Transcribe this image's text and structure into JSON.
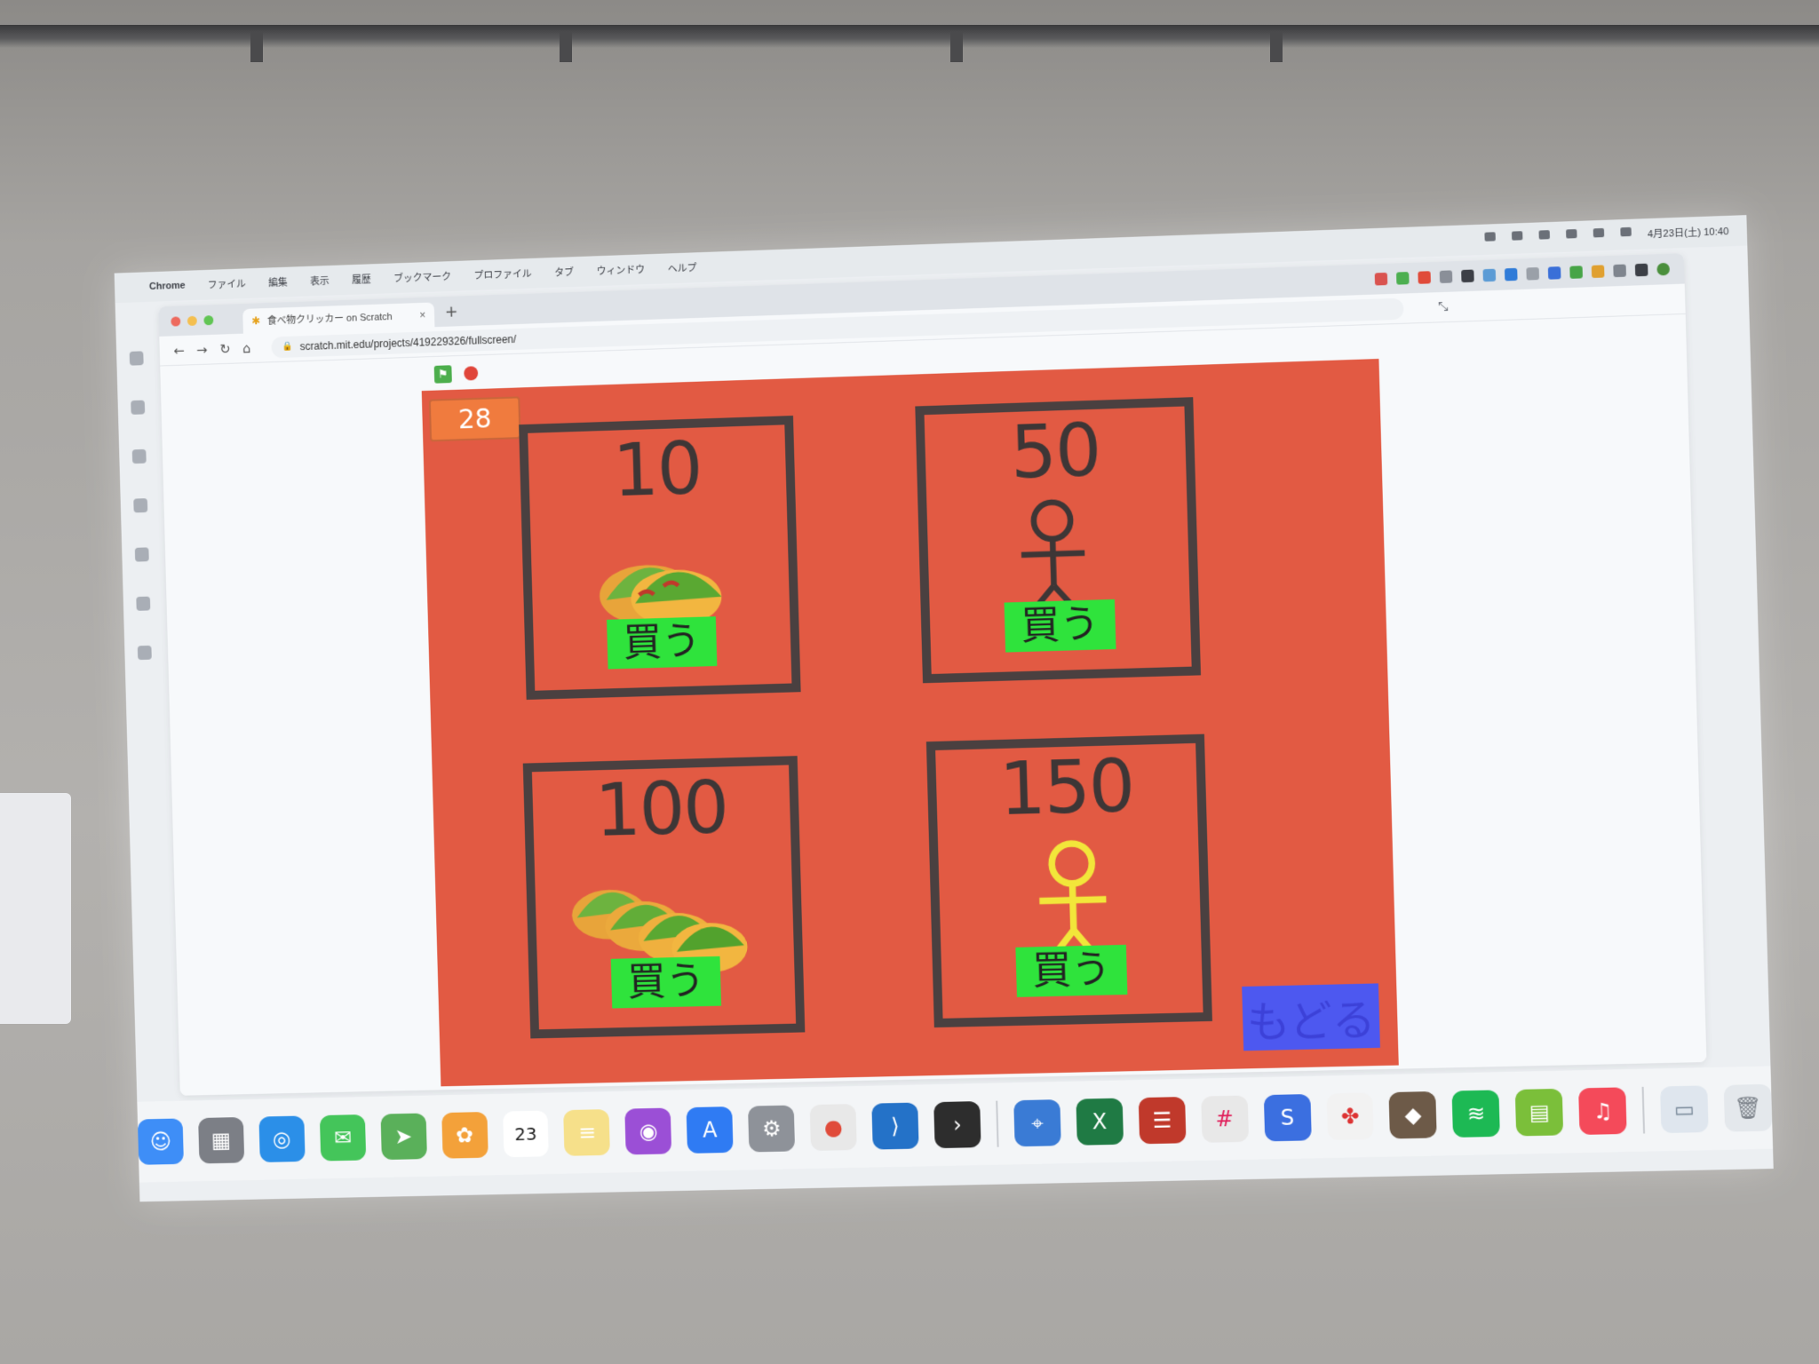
{
  "menubar": {
    "app_name": "Chrome",
    "items": [
      "ファイル",
      "編集",
      "表示",
      "履歴",
      "ブックマーク",
      "プロファイル",
      "タブ",
      "ウィンドウ",
      "ヘルプ"
    ],
    "clock": "4月23日(土) 10:40"
  },
  "browser": {
    "tab_title": "食べ物クリッカー on Scratch",
    "url": "scratch.mit.edu/projects/419229326/fullscreen/"
  },
  "game": {
    "score": "28",
    "cards": [
      {
        "price": "10",
        "buy_label": "買う",
        "icon": "taco-icon"
      },
      {
        "price": "50",
        "buy_label": "買う",
        "icon": "stick-figure-icon"
      },
      {
        "price": "100",
        "buy_label": "買う",
        "icon": "tacos-stack-icon"
      },
      {
        "price": "150",
        "buy_label": "買う",
        "icon": "yellow-stick-figure-icon"
      }
    ],
    "back_label": "もどる"
  },
  "colors": {
    "stage": "#e25a43",
    "buy_button": "#2fe33c",
    "back_button": "#4d58f0",
    "score_box": "#f07b3e"
  },
  "dock": {
    "calendar_day": "23"
  }
}
